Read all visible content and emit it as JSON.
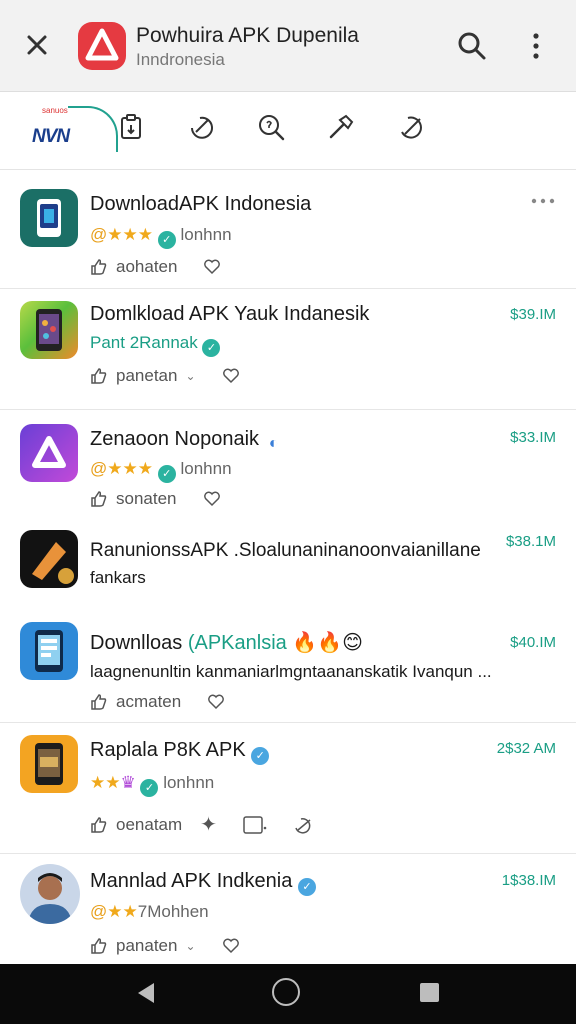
{
  "header": {
    "title": "Powhuira  APK Dupenila",
    "subtitle": "Inndronesia"
  },
  "categories": {
    "logo_small": "sanuos",
    "logo_text": "NVN",
    "icons": [
      "clipboard-icon",
      "edit-icon",
      "search-doc-icon",
      "hammer-icon",
      "send-icon"
    ]
  },
  "apps": [
    {
      "name": "DownloadAPK Indonesia",
      "rating_prefix": "@",
      "rating_stars": "★★★",
      "meta_text": "lonhnn",
      "action_label": "aohaten",
      "price": "",
      "accent": "#1b6f66"
    },
    {
      "name": "Domlkload APK Yauk Indanesik",
      "meta_text": "Pant 2Rannak",
      "action_label": "panetan",
      "price": "$39.IM",
      "accent": "#7ac142"
    },
    {
      "name": "Zenaoon Noponaik",
      "rating_prefix": "@",
      "rating_stars": "★★★",
      "meta_text": "lonhnn",
      "action_label": "sonaten",
      "price": "$33.IM",
      "accent": "#8b3fd6"
    },
    {
      "name": "RanunionssAPK .Sloalunaninanoonvaianillane",
      "line2": "fankars",
      "price": "$38.1M",
      "accent": "#d97a26"
    },
    {
      "name": "Downlloas",
      "name_highlight": "(APKanlsia",
      "emojis": "🔥🔥😊",
      "line2": "laagnenunltin  kanmaniarlmgntaananskatik Ivanqun ...",
      "action_label": "acmaten",
      "price": "$40.IM",
      "accent": "#2f8ad8"
    },
    {
      "name": "Raplala P8K APK",
      "rating_stars": "★★",
      "meta_text": "lonhnn",
      "action_label": "oenatam",
      "price": "2$32 AM",
      "accent": "#f0a020"
    },
    {
      "name": "Mannlad APK Indkenia",
      "rating_prefix": "@",
      "rating_stars": "★★",
      "meta_text": "7Mohhen",
      "action_label": "panaten",
      "price": "1$38.IM",
      "accent": "#3b6aa0"
    }
  ]
}
